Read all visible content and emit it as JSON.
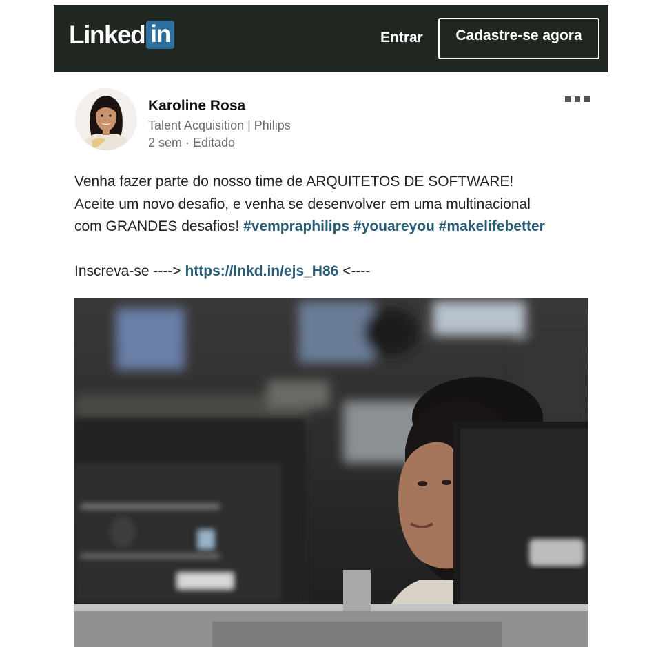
{
  "header": {
    "logo_text": "Linked",
    "logo_box_text": "in",
    "signin_label": "Entrar",
    "join_label": "Cadastre-se agora",
    "background_color": "#1f2720",
    "brand_color": "#2d6f9a"
  },
  "post": {
    "author": {
      "name": "Karoline Rosa",
      "headline": "Talent Acquisition | Philips",
      "meta": "2 sem · Editado"
    },
    "more_icon": "ellipsis-icon",
    "text": {
      "line1": "Venha fazer parte do nosso time de ARQUITETOS DE SOFTWARE!",
      "line2": "Aceite um novo desafio, e venha se desenvolver em uma multinacional",
      "line3_prefix": "com GRANDES desafios! ",
      "hashtags": [
        "#vempraphilips",
        "#youareyou",
        "#makelifebetter"
      ],
      "signup_prefix": "Inscreva-se ----> ",
      "signup_link": "https://lnkd.in/ejs_H86",
      "signup_suffix": " <----"
    },
    "link_color": "#2a5d78"
  }
}
